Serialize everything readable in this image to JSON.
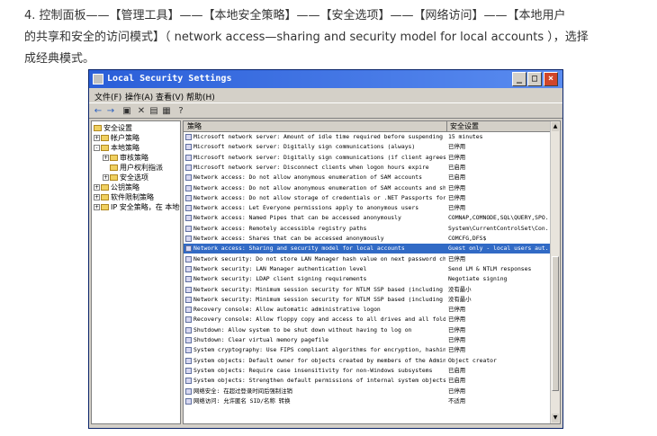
{
  "article": {
    "line1": "4. 控制面板——【管理工具】——【本地安全策略】——【安全选项】——【网络访问】——【本地用户",
    "line2": "的共享和安全的访问模式】（ network access—sharing and security model for local accounts ），选择",
    "line3": "成经典模式。"
  },
  "window": {
    "title": "Local Security Settings",
    "menu": [
      "文件(F)",
      "操作(A)",
      "查看(V)",
      "帮助(H)"
    ],
    "tree": [
      {
        "label": "安全设置",
        "level": 0,
        "expander": ""
      },
      {
        "label": "帐户策略",
        "level": 1,
        "expander": "+"
      },
      {
        "label": "本地策略",
        "level": 1,
        "expander": "-"
      },
      {
        "label": "审核策略",
        "level": 2,
        "expander": "+"
      },
      {
        "label": "用户权利指派",
        "level": 2,
        "expander": ""
      },
      {
        "label": "安全选项",
        "level": 2,
        "expander": "+"
      },
      {
        "label": "公钥策略",
        "level": 1,
        "expander": "+"
      },
      {
        "label": "软件限制策略",
        "level": 1,
        "expander": "+"
      },
      {
        "label": "IP 安全策略，在 本地计",
        "level": 1,
        "expander": "+"
      }
    ],
    "columns": {
      "policy": "策略",
      "setting": "安全设置"
    },
    "rows": [
      {
        "name": "Microsoft network server: Amount of idle time required before suspending session",
        "value": "15 minutes"
      },
      {
        "name": "Microsoft network server: Digitally sign communications (always)",
        "value": "已停用"
      },
      {
        "name": "Microsoft network server: Digitally sign communications (if client agrees)",
        "value": "已停用"
      },
      {
        "name": "Microsoft network server: Disconnect clients when logon hours expire",
        "value": "已启用"
      },
      {
        "name": "Network access: Do not allow anonymous enumeration of SAM accounts",
        "value": "已启用"
      },
      {
        "name": "Network access: Do not allow anonymous enumeration of SAM accounts and shares",
        "value": "已停用"
      },
      {
        "name": "Network access: Do not allow storage of credentials or .NET Passports for netw...",
        "value": "已停用"
      },
      {
        "name": "Network access: Let Everyone permissions apply to anonymous users",
        "value": "已停用"
      },
      {
        "name": "Network access: Named Pipes that can be accessed anonymously",
        "value": "COMNAP,COMNODE,SQL\\QUERY,SPO..."
      },
      {
        "name": "Network access: Remotely accessible registry paths",
        "value": "System\\CurrentControlSet\\Con..."
      },
      {
        "name": "Network access: Shares that can be accessed anonymously",
        "value": "COMCFG,DFS$"
      },
      {
        "name": "Network access: Sharing and security model for local accounts",
        "value": "Guest only - local users aut..."
      },
      {
        "name": "Network security: Do not store LAN Manager hash value on next password change",
        "value": "已停用"
      },
      {
        "name": "Network security: LAN Manager authentication level",
        "value": "Send LM & NTLM responses"
      },
      {
        "name": "Network security: LDAP client signing requirements",
        "value": "Negotiate signing"
      },
      {
        "name": "Network security: Minimum session security for NTLM SSP based (including secur...",
        "value": "没有最小"
      },
      {
        "name": "Network security: Minimum session security for NTLM SSP based (including secur...",
        "value": "没有最小"
      },
      {
        "name": "Recovery console: Allow automatic administrative logon",
        "value": "已停用"
      },
      {
        "name": "Recovery console: Allow floppy copy and access to all drives and all folders",
        "value": "已停用"
      },
      {
        "name": "Shutdown: Allow system to be shut down without having to log on",
        "value": "已停用"
      },
      {
        "name": "Shutdown: Clear virtual memory pagefile",
        "value": "已停用"
      },
      {
        "name": "System cryptography: Use FIPS compliant algorithms for encryption, hashing, an...",
        "value": "已停用"
      },
      {
        "name": "System objects: Default owner for objects created by members of the Administra...",
        "value": "Object creator"
      },
      {
        "name": "System objects: Require case insensitivity for non-Windows subsystems",
        "value": "已启用"
      },
      {
        "name": "System objects: Strengthen default permissions of internal system objects (e.g...",
        "value": "已启用"
      },
      {
        "name": "网络安全: 在超过登录时间后强制注销",
        "value": "已停用"
      },
      {
        "name": "网络访问: 允许匿名 SID/名称 转换",
        "value": "不适用"
      }
    ]
  }
}
